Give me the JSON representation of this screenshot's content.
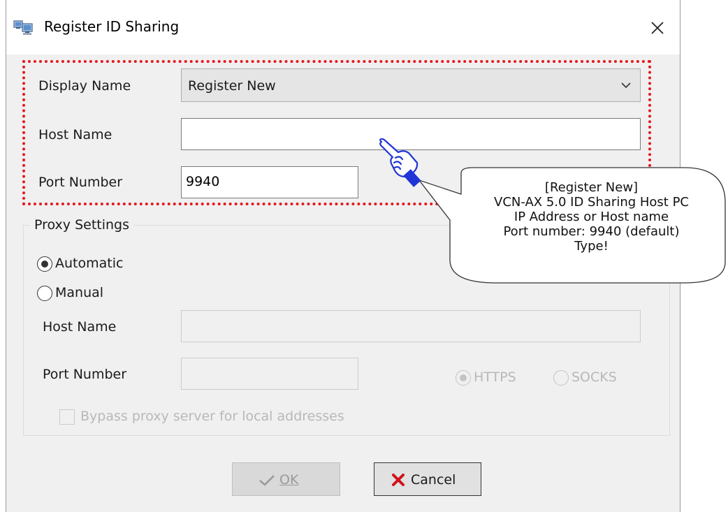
{
  "window": {
    "title": "Register ID Sharing",
    "icons": {
      "app": "network-computers-icon",
      "close": "close-icon"
    }
  },
  "form": {
    "display_name": {
      "label": "Display Name",
      "value": "Register New"
    },
    "host_name": {
      "label": "Host Name",
      "value": ""
    },
    "port_number": {
      "label": "Port Number",
      "value": "9940"
    }
  },
  "proxy": {
    "group_label": "Proxy Settings",
    "mode_options": [
      {
        "label": "Automatic",
        "selected": true
      },
      {
        "label": "Manual",
        "selected": false
      }
    ],
    "host_name_label": "Host Name",
    "host_name_value": "",
    "port_number_label": "Port Number",
    "port_number_value": "",
    "protocol_options": [
      {
        "label": "HTTPS",
        "selected": true
      },
      {
        "label": "SOCKS",
        "selected": false
      }
    ],
    "bypass_label": "Bypass proxy server for local addresses",
    "bypass_checked": false
  },
  "buttons": {
    "ok_label": "OK",
    "cancel_label": "Cancel"
  },
  "annotation": {
    "highlight_color": "#e6161d",
    "callout_lines": [
      "[Register New]",
      "VCN-AX 5.0 ID Sharing Host PC",
      "IP Address or Host name",
      "Port number: 9940 (default)",
      "Type!"
    ],
    "pointer_icon": "pointing-hand-icon"
  },
  "colors": {
    "dialog_bg": "#f0f0f0",
    "callout_fill": "#ffffff",
    "hand_color": "#1f35d6",
    "cancel_x": "#d0121b"
  }
}
